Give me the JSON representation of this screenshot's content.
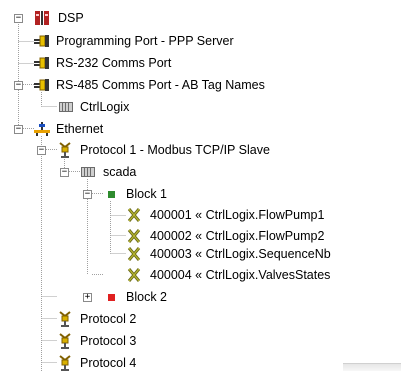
{
  "tree": {
    "root": {
      "label": "DSP",
      "icon": "dsp-device-icon",
      "toggle": "−"
    },
    "ports": [
      {
        "label": "Programming Port - PPP Server",
        "icon": "port-connector-icon"
      },
      {
        "label": "RS-232 Comms Port",
        "icon": "port-connector-icon"
      },
      {
        "label": "RS-485 Comms Port - AB Tag Names",
        "icon": "port-connector-icon",
        "toggle": "−"
      }
    ],
    "rs485_children": [
      {
        "label": "CtrlLogix",
        "icon": "device-block-icon"
      }
    ],
    "ethernet": {
      "label": "Ethernet",
      "icon": "ethernet-network-icon",
      "toggle": "−"
    },
    "protocols": [
      {
        "label": "Protocol 1 - Modbus TCP/IP Slave",
        "icon": "protocol-plug-icon",
        "toggle": "−"
      },
      {
        "label": "Protocol 2",
        "icon": "protocol-plug-icon"
      },
      {
        "label": "Protocol 3",
        "icon": "protocol-plug-icon"
      },
      {
        "label": "Protocol 4",
        "icon": "protocol-plug-icon"
      }
    ],
    "scada": {
      "label": "scada",
      "icon": "device-block-icon",
      "toggle": "−"
    },
    "blocks": [
      {
        "label": "Block 1",
        "icon": "block-status-icon",
        "status_color": "#2e8b2e",
        "toggle": "−",
        "mappings": [
          {
            "label": "400001 « CtrlLogix.FlowPump1",
            "icon": "mapping-cross-icon"
          },
          {
            "label": "400002 « CtrlLogix.FlowPump2",
            "icon": "mapping-cross-icon"
          },
          {
            "label": "400003 « CtrlLogix.SequenceNb",
            "icon": "mapping-cross-icon"
          },
          {
            "label": "400004 « CtrlLogix.ValvesStates",
            "icon": "mapping-cross-icon"
          }
        ]
      },
      {
        "label": "Block 2",
        "icon": "block-status-icon",
        "status_color": "#e02020",
        "toggle": "+"
      }
    ]
  }
}
